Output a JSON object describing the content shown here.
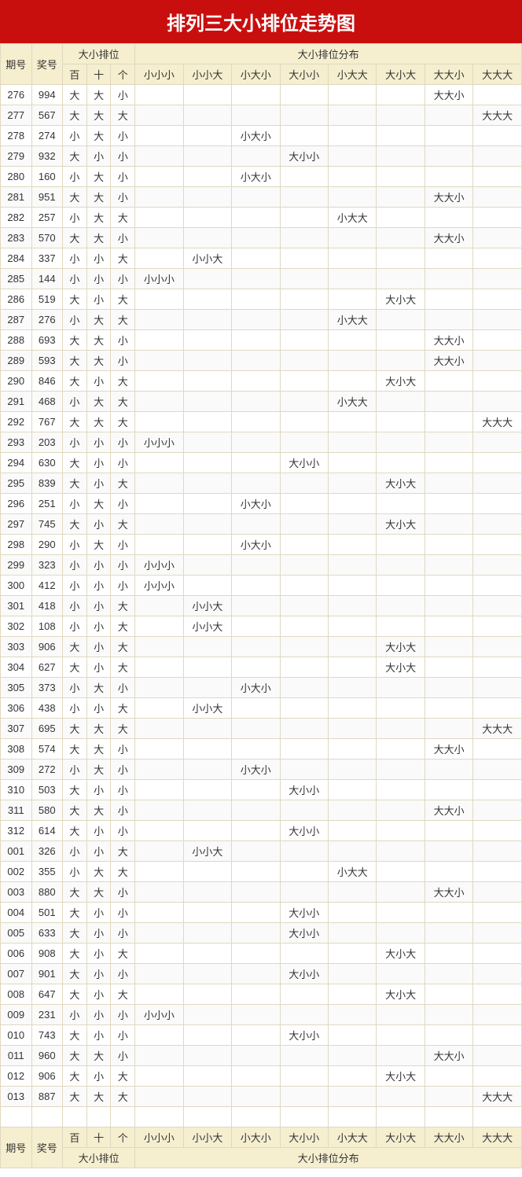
{
  "title": "排列三大小排位走势图",
  "headers": {
    "period": "期号",
    "number": "奖号",
    "pos_group": "大小排位",
    "dist_group": "大小排位分布",
    "pos_cols": [
      "百",
      "十",
      "个"
    ],
    "dist_cols": [
      "小小小",
      "小小大",
      "小大小",
      "大小小",
      "小大大",
      "大小大",
      "大大小",
      "大大大"
    ]
  },
  "chart_data": {
    "type": "table",
    "title": "排列三大小排位走势图",
    "columns": [
      "期号",
      "奖号",
      "百",
      "十",
      "个",
      "小小小",
      "小小大",
      "小大小",
      "大小小",
      "小大大",
      "大小大",
      "大大小",
      "大大大"
    ],
    "rows": [
      {
        "period": "276",
        "num": "994",
        "pos": [
          "大",
          "大",
          "小"
        ],
        "hit": "大大小"
      },
      {
        "period": "277",
        "num": "567",
        "pos": [
          "大",
          "大",
          "大"
        ],
        "hit": "大大大"
      },
      {
        "period": "278",
        "num": "274",
        "pos": [
          "小",
          "大",
          "小"
        ],
        "hit": "小大小"
      },
      {
        "period": "279",
        "num": "932",
        "pos": [
          "大",
          "小",
          "小"
        ],
        "hit": "大小小"
      },
      {
        "period": "280",
        "num": "160",
        "pos": [
          "小",
          "大",
          "小"
        ],
        "hit": "小大小"
      },
      {
        "period": "281",
        "num": "951",
        "pos": [
          "大",
          "大",
          "小"
        ],
        "hit": "大大小"
      },
      {
        "period": "282",
        "num": "257",
        "pos": [
          "小",
          "大",
          "大"
        ],
        "hit": "小大大"
      },
      {
        "period": "283",
        "num": "570",
        "pos": [
          "大",
          "大",
          "小"
        ],
        "hit": "大大小"
      },
      {
        "period": "284",
        "num": "337",
        "pos": [
          "小",
          "小",
          "大"
        ],
        "hit": "小小大"
      },
      {
        "period": "285",
        "num": "144",
        "pos": [
          "小",
          "小",
          "小"
        ],
        "hit": "小小小"
      },
      {
        "period": "286",
        "num": "519",
        "pos": [
          "大",
          "小",
          "大"
        ],
        "hit": "大小大"
      },
      {
        "period": "287",
        "num": "276",
        "pos": [
          "小",
          "大",
          "大"
        ],
        "hit": "小大大"
      },
      {
        "period": "288",
        "num": "693",
        "pos": [
          "大",
          "大",
          "小"
        ],
        "hit": "大大小"
      },
      {
        "period": "289",
        "num": "593",
        "pos": [
          "大",
          "大",
          "小"
        ],
        "hit": "大大小"
      },
      {
        "period": "290",
        "num": "846",
        "pos": [
          "大",
          "小",
          "大"
        ],
        "hit": "大小大"
      },
      {
        "period": "291",
        "num": "468",
        "pos": [
          "小",
          "大",
          "大"
        ],
        "hit": "小大大"
      },
      {
        "period": "292",
        "num": "767",
        "pos": [
          "大",
          "大",
          "大"
        ],
        "hit": "大大大"
      },
      {
        "period": "293",
        "num": "203",
        "pos": [
          "小",
          "小",
          "小"
        ],
        "hit": "小小小"
      },
      {
        "period": "294",
        "num": "630",
        "pos": [
          "大",
          "小",
          "小"
        ],
        "hit": "大小小"
      },
      {
        "period": "295",
        "num": "839",
        "pos": [
          "大",
          "小",
          "大"
        ],
        "hit": "大小大"
      },
      {
        "period": "296",
        "num": "251",
        "pos": [
          "小",
          "大",
          "小"
        ],
        "hit": "小大小"
      },
      {
        "period": "297",
        "num": "745",
        "pos": [
          "大",
          "小",
          "大"
        ],
        "hit": "大小大"
      },
      {
        "period": "298",
        "num": "290",
        "pos": [
          "小",
          "大",
          "小"
        ],
        "hit": "小大小"
      },
      {
        "period": "299",
        "num": "323",
        "pos": [
          "小",
          "小",
          "小"
        ],
        "hit": "小小小"
      },
      {
        "period": "300",
        "num": "412",
        "pos": [
          "小",
          "小",
          "小"
        ],
        "hit": "小小小"
      },
      {
        "period": "301",
        "num": "418",
        "pos": [
          "小",
          "小",
          "大"
        ],
        "hit": "小小大"
      },
      {
        "period": "302",
        "num": "108",
        "pos": [
          "小",
          "小",
          "大"
        ],
        "hit": "小小大"
      },
      {
        "period": "303",
        "num": "906",
        "pos": [
          "大",
          "小",
          "大"
        ],
        "hit": "大小大"
      },
      {
        "period": "304",
        "num": "627",
        "pos": [
          "大",
          "小",
          "大"
        ],
        "hit": "大小大"
      },
      {
        "period": "305",
        "num": "373",
        "pos": [
          "小",
          "大",
          "小"
        ],
        "hit": "小大小"
      },
      {
        "period": "306",
        "num": "438",
        "pos": [
          "小",
          "小",
          "大"
        ],
        "hit": "小小大"
      },
      {
        "period": "307",
        "num": "695",
        "pos": [
          "大",
          "大",
          "大"
        ],
        "hit": "大大大"
      },
      {
        "period": "308",
        "num": "574",
        "pos": [
          "大",
          "大",
          "小"
        ],
        "hit": "大大小"
      },
      {
        "period": "309",
        "num": "272",
        "pos": [
          "小",
          "大",
          "小"
        ],
        "hit": "小大小"
      },
      {
        "period": "310",
        "num": "503",
        "pos": [
          "大",
          "小",
          "小"
        ],
        "hit": "大小小"
      },
      {
        "period": "311",
        "num": "580",
        "pos": [
          "大",
          "大",
          "小"
        ],
        "hit": "大大小"
      },
      {
        "period": "312",
        "num": "614",
        "pos": [
          "大",
          "小",
          "小"
        ],
        "hit": "大小小"
      },
      {
        "period": "001",
        "num": "326",
        "pos": [
          "小",
          "小",
          "大"
        ],
        "hit": "小小大"
      },
      {
        "period": "002",
        "num": "355",
        "pos": [
          "小",
          "大",
          "大"
        ],
        "hit": "小大大"
      },
      {
        "period": "003",
        "num": "880",
        "pos": [
          "大",
          "大",
          "小"
        ],
        "hit": "大大小"
      },
      {
        "period": "004",
        "num": "501",
        "pos": [
          "大",
          "小",
          "小"
        ],
        "hit": "大小小"
      },
      {
        "period": "005",
        "num": "633",
        "pos": [
          "大",
          "小",
          "小"
        ],
        "hit": "大小小"
      },
      {
        "period": "006",
        "num": "908",
        "pos": [
          "大",
          "小",
          "大"
        ],
        "hit": "大小大"
      },
      {
        "period": "007",
        "num": "901",
        "pos": [
          "大",
          "小",
          "小"
        ],
        "hit": "大小小"
      },
      {
        "period": "008",
        "num": "647",
        "pos": [
          "大",
          "小",
          "大"
        ],
        "hit": "大小大"
      },
      {
        "period": "009",
        "num": "231",
        "pos": [
          "小",
          "小",
          "小"
        ],
        "hit": "小小小"
      },
      {
        "period": "010",
        "num": "743",
        "pos": [
          "大",
          "小",
          "小"
        ],
        "hit": "大小小"
      },
      {
        "period": "011",
        "num": "960",
        "pos": [
          "大",
          "大",
          "小"
        ],
        "hit": "大大小"
      },
      {
        "period": "012",
        "num": "906",
        "pos": [
          "大",
          "小",
          "大"
        ],
        "hit": "大小大"
      },
      {
        "period": "013",
        "num": "887",
        "pos": [
          "大",
          "大",
          "大"
        ],
        "hit": "大大大"
      }
    ]
  }
}
